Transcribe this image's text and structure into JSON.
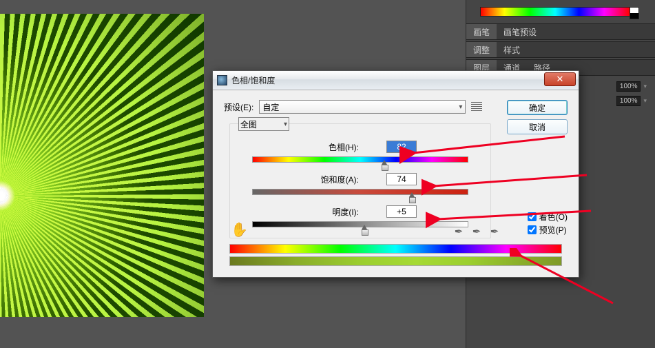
{
  "panels": {
    "brush_tab": "画笔",
    "brush_preset_tab": "画笔预设",
    "adjust_tab": "调整",
    "style_tab": "样式",
    "layer_tab": "图层",
    "channel_tab": "通道",
    "path_tab": "路径",
    "opacity_value": "100%"
  },
  "dialog": {
    "title": "色相/饱和度",
    "preset_label": "预设(E):",
    "preset_value": "自定",
    "ok": "确定",
    "cancel": "取消",
    "scope": "全图",
    "hue_label": "色相(H):",
    "hue_value": "82",
    "sat_label": "饱和度(A):",
    "sat_value": "74",
    "light_label": "明度(I):",
    "light_value": "+5",
    "colorize_label": "着色(O)",
    "preview_label": "预览(P)"
  }
}
